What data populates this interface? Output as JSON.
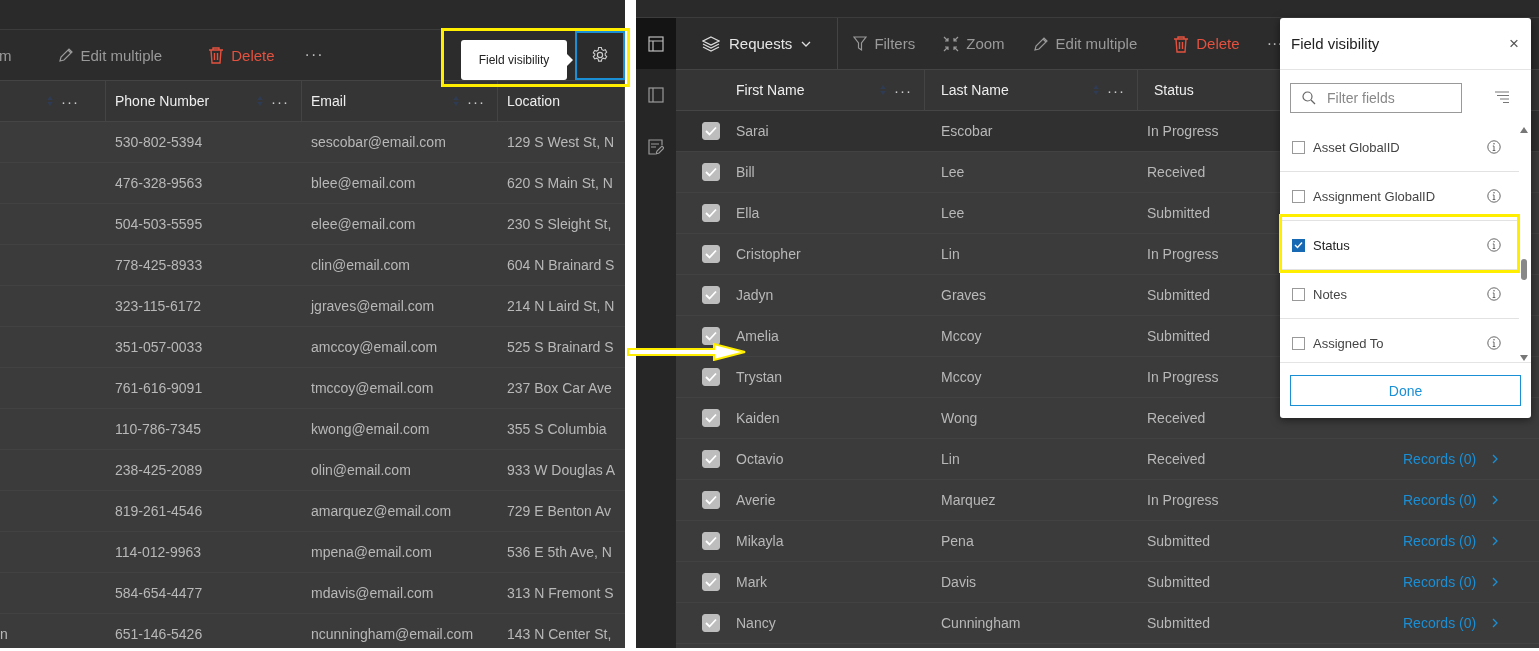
{
  "left_view": {
    "toolbar": {
      "cut_item": "m",
      "edit_multiple": "Edit multiple",
      "delete": "Delete",
      "more": "···",
      "tooltip": "Field visibility"
    },
    "table": {
      "columns": [
        {
          "menu": "···"
        },
        {
          "label": "Phone Number",
          "menu": "···"
        },
        {
          "label": "Email",
          "menu": "···"
        },
        {
          "label": "Location"
        }
      ],
      "rows": [
        {
          "phone": "530-802-5394",
          "email": "sescobar@email.com",
          "location": "129 S West St, N"
        },
        {
          "phone": "476-328-9563",
          "email": "blee@email.com",
          "location": "620 S Main St, N"
        },
        {
          "phone": "504-503-5595",
          "email": "elee@email.com",
          "location": "230 S Sleight St,"
        },
        {
          "phone": "778-425-8933",
          "email": "clin@email.com",
          "location": "604 N Brainard S"
        },
        {
          "phone": "323-115-6172",
          "email": "jgraves@email.com",
          "location": "214 N Laird St, N"
        },
        {
          "phone": "351-057-0033",
          "email": "amccoy@email.com",
          "location": "525 S Brainard S"
        },
        {
          "phone": "761-616-9091",
          "email": "tmccoy@email.com",
          "location": "237 Box Car Ave"
        },
        {
          "phone": "110-786-7345",
          "email": "kwong@email.com",
          "location": "355 S Columbia"
        },
        {
          "phone": "238-425-2089",
          "email": "olin@email.com",
          "location": "933 W Douglas A"
        },
        {
          "phone": "819-261-4546",
          "email": "amarquez@email.com",
          "location": "729 E Benton Av"
        },
        {
          "phone": "114-012-9963",
          "email": "mpena@email.com",
          "location": "536 E 5th Ave, N"
        },
        {
          "phone": "584-654-4477",
          "email": "mdavis@email.com",
          "location": "313 N Fremont S"
        },
        {
          "column_1": "n",
          "phone": "651-146-5426",
          "email": "ncunningham@email.com",
          "location": "143 N Center St,"
        }
      ]
    }
  },
  "right_view": {
    "toolbar": {
      "layer": "Requests",
      "filters": "Filters",
      "zoom": "Zoom",
      "edit_multiple": "Edit multiple",
      "delete": "Delete",
      "more": "···"
    },
    "table": {
      "columns": [
        {
          "label": "First Name",
          "menu": "···"
        },
        {
          "label": "Last Name",
          "menu": "···"
        },
        {
          "label": "Status"
        }
      ],
      "rows": [
        {
          "first": "Sarai",
          "last": "Escobar",
          "status": "In Progress",
          "checked": true
        },
        {
          "first": "Bill",
          "last": "Lee",
          "status": "Received",
          "checked": true
        },
        {
          "first": "Ella",
          "last": "Lee",
          "status": "Submitted",
          "checked": true
        },
        {
          "first": "Cristopher",
          "last": "Lin",
          "status": "In Progress",
          "checked": true
        },
        {
          "first": "Jadyn",
          "last": "Graves",
          "status": "Submitted",
          "checked": true
        },
        {
          "first": "Amelia",
          "last": "Mccoy",
          "status": "Submitted",
          "checked": true
        },
        {
          "first": "Trystan",
          "last": "Mccoy",
          "status": "In Progress",
          "checked": true
        },
        {
          "first": "Kaiden",
          "last": "Wong",
          "status": "Received",
          "checked": true
        },
        {
          "first": "Octavio",
          "last": "Lin",
          "status": "Received",
          "checked": true,
          "records": "Records (0)"
        },
        {
          "first": "Averie",
          "last": "Marquez",
          "status": "In Progress",
          "checked": true,
          "records": "Records (0)"
        },
        {
          "first": "Mikayla",
          "last": "Pena",
          "status": "Submitted",
          "checked": true,
          "records": "Records (0)"
        },
        {
          "first": "Mark",
          "last": "Davis",
          "status": "Submitted",
          "checked": true,
          "records": "Records (0)"
        },
        {
          "first": "Nancy",
          "last": "Cunningham",
          "status": "Submitted",
          "checked": true,
          "records": "Records (0)"
        }
      ]
    },
    "field_visibility": {
      "title": "Field visibility",
      "close": "×",
      "search": {
        "placeholder": "Filter fields"
      },
      "fields": [
        {
          "label": "Asset GlobalID",
          "checked": false
        },
        {
          "label": "Assignment GlobalID",
          "checked": false
        },
        {
          "label": "Status",
          "checked": true
        },
        {
          "label": "Notes",
          "checked": false
        },
        {
          "label": "Assigned To",
          "checked": false
        }
      ],
      "done": "Done"
    }
  }
}
